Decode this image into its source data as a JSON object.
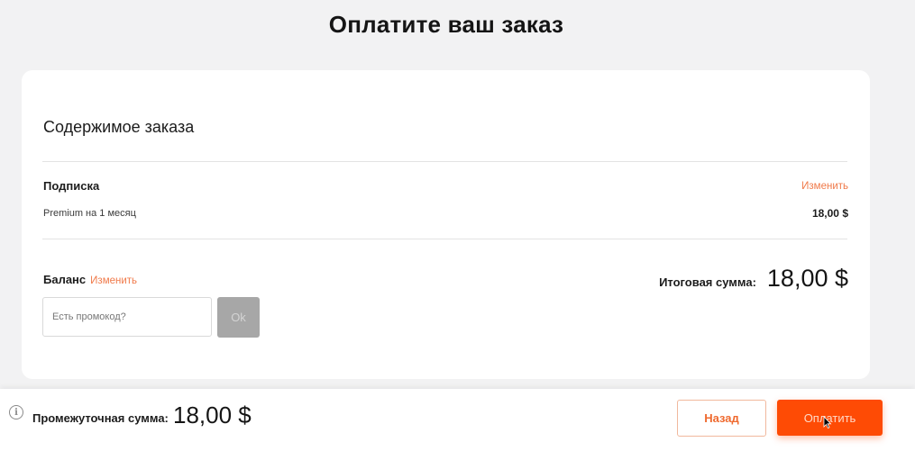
{
  "page": {
    "title": "Оплатите ваш заказ"
  },
  "order": {
    "section_title": "Содержимое заказа",
    "subscription_label": "Подписка",
    "change_label": "Изменить",
    "item_name": "Premium на 1 месяц",
    "item_price": "18,00 $",
    "balance_label": "Баланс",
    "balance_change_label": "Изменить",
    "total_label": "Итоговая сумма:",
    "total_value": "18,00 $",
    "promo_placeholder": "Есть промокод?",
    "promo_value": "",
    "ok_label": "Ok"
  },
  "footer": {
    "info_icon": "info-icon",
    "subtotal_label": "Промежуточная сумма:",
    "subtotal_value": "18,00 $",
    "back_label": "Назад",
    "pay_label": "Оплатить"
  },
  "colors": {
    "accent": "#fe4b05",
    "link": "#f07a4a",
    "background": "#f2f2f3"
  }
}
